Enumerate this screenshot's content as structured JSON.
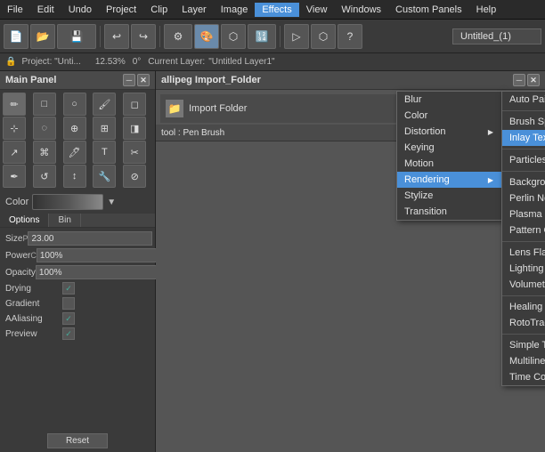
{
  "menubar": {
    "items": [
      "File",
      "Edit",
      "Undo",
      "Project",
      "Clip",
      "Layer",
      "Image",
      "Effects",
      "View",
      "Windows",
      "Custom Panels",
      "Help"
    ]
  },
  "toolbar": {
    "title": "Untitled_(1)"
  },
  "status": {
    "zoom": "12.53%",
    "angle": "0°",
    "layer_label": "Current Layer:",
    "layer_name": "\"Untitled Layer1\""
  },
  "panels": {
    "main_panel": {
      "title": "Main Panel"
    },
    "import_panel": {
      "title": "allipeg Import_Folder",
      "label": "Import Folder"
    },
    "brush_panel": {
      "title": "tool : Pen Brush"
    }
  },
  "properties": {
    "color_label": "Color",
    "tabs": [
      "Options",
      "Bin"
    ],
    "size_label": "Size",
    "size_icon": "P",
    "size_value": "23.00",
    "power_label": "Power",
    "power_icon": "C",
    "power_value": "100%",
    "opacity_label": "Opacity",
    "opacity_value": "100%",
    "drying_label": "Drying",
    "drying_checked": true,
    "gradient_label": "Gradient",
    "gradient_checked": false,
    "aaliasing_label": "AAliasing",
    "aaliasing_checked": true,
    "preview_label": "Preview",
    "preview_checked": true,
    "reset_label": "Reset"
  },
  "effects_menu": {
    "items": [
      {
        "label": "Blur",
        "has_sub": false
      },
      {
        "label": "Color",
        "has_sub": false
      },
      {
        "label": "Distortion",
        "has_sub": true
      },
      {
        "label": "Keying",
        "has_sub": false
      },
      {
        "label": "Motion",
        "has_sub": false
      },
      {
        "label": "Rendering",
        "has_sub": true,
        "active": true
      },
      {
        "label": "Stylize",
        "has_sub": false
      },
      {
        "label": "Transition",
        "has_sub": false
      }
    ]
  },
  "rendering_submenu": {
    "groups": [
      {
        "items": [
          {
            "label": "Auto Paint",
            "highlighted": false
          }
        ]
      },
      {
        "items": [
          {
            "label": "Brush Spreading",
            "highlighted": false
          },
          {
            "label": "Inlay Texture",
            "highlighted": true
          }
        ]
      },
      {
        "items": [
          {
            "label": "Particles Generator",
            "highlighted": false
          }
        ]
      },
      {
        "items": [
          {
            "label": "Background Generator",
            "highlighted": false
          },
          {
            "label": "Perlin Noise",
            "highlighted": false
          },
          {
            "label": "Plasma",
            "highlighted": false
          },
          {
            "label": "Pattern Generator",
            "highlighted": false
          }
        ]
      },
      {
        "items": [
          {
            "label": "Lens Flare",
            "highlighted": false
          },
          {
            "label": "Lighting",
            "highlighted": false
          },
          {
            "label": "Volumetric Light",
            "highlighted": false
          }
        ]
      },
      {
        "items": [
          {
            "label": "Healing Tracker",
            "highlighted": false
          },
          {
            "label": "RotoTracking",
            "highlighted": false
          }
        ]
      },
      {
        "items": [
          {
            "label": "Simple Text",
            "highlighted": false
          },
          {
            "label": "Multiline Text",
            "highlighted": false
          },
          {
            "label": "Time Code Generator",
            "highlighted": false
          }
        ]
      }
    ]
  }
}
